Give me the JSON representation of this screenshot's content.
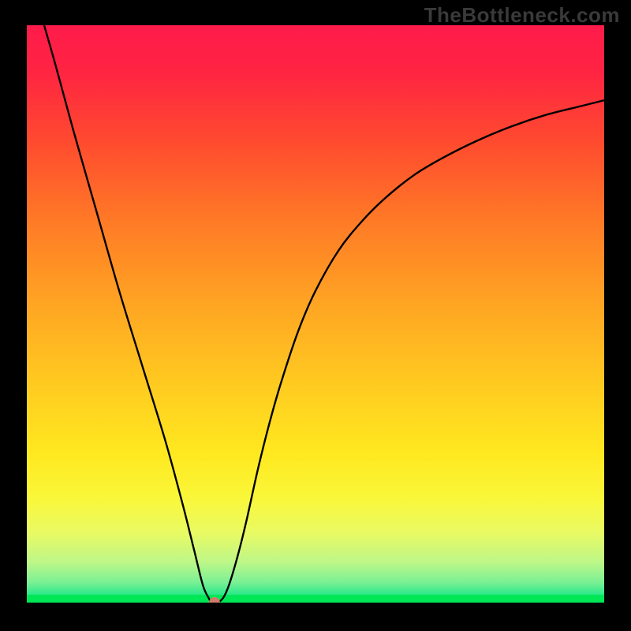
{
  "watermark": "TheBottleneck.com",
  "chart_data": {
    "type": "line",
    "title": "",
    "xlabel": "",
    "ylabel": "",
    "xlim": [
      0,
      100
    ],
    "ylim": [
      0,
      100
    ],
    "grid": false,
    "legend": false,
    "series": [
      {
        "name": "bottleneck-curve",
        "x": [
          3,
          5,
          8,
          12,
          16,
          20,
          24,
          27,
          29,
          30.5,
          31.5,
          32,
          33,
          34,
          35,
          36.5,
          38,
          40,
          42,
          44,
          47,
          50,
          54,
          58,
          62,
          67,
          72,
          78,
          84,
          90,
          96,
          100
        ],
        "y": [
          100,
          93,
          82,
          68,
          54,
          41,
          28,
          17,
          9,
          3,
          0.8,
          0,
          0,
          0.8,
          3,
          8,
          14,
          23,
          31,
          38,
          47,
          54,
          61,
          66,
          70,
          74,
          77,
          80,
          82.5,
          84.5,
          86,
          87
        ]
      }
    ],
    "marker": {
      "x": 32.5,
      "y": 0
    },
    "background_gradient": {
      "stops": [
        {
          "offset": 0.0,
          "color": "#ff1b4b"
        },
        {
          "offset": 0.08,
          "color": "#ff2442"
        },
        {
          "offset": 0.2,
          "color": "#ff4a2f"
        },
        {
          "offset": 0.34,
          "color": "#ff7a26"
        },
        {
          "offset": 0.48,
          "color": "#ffa423"
        },
        {
          "offset": 0.62,
          "color": "#ffca20"
        },
        {
          "offset": 0.74,
          "color": "#ffe81f"
        },
        {
          "offset": 0.82,
          "color": "#faf73a"
        },
        {
          "offset": 0.88,
          "color": "#e8fa64"
        },
        {
          "offset": 0.93,
          "color": "#bdf788"
        },
        {
          "offset": 0.965,
          "color": "#7af094"
        },
        {
          "offset": 0.985,
          "color": "#2ee98b"
        },
        {
          "offset": 1.0,
          "color": "#00e756"
        }
      ]
    },
    "curve_color": "#000000",
    "marker_color": "#cf7a6a"
  }
}
